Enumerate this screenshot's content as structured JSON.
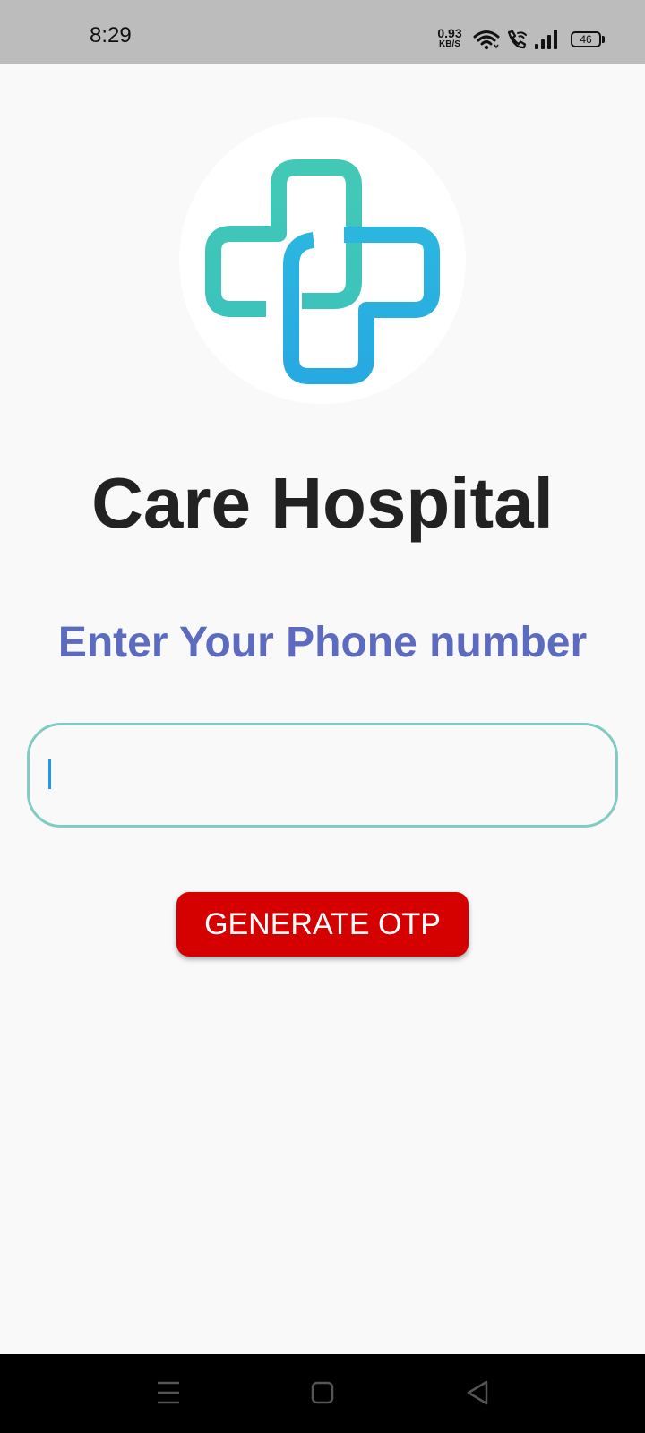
{
  "status_bar": {
    "time": "8:29",
    "net_speed_value": "0.93",
    "net_speed_unit": "KB/S",
    "battery_level": "46",
    "icons": [
      "wifi-icon",
      "wifi-call-icon",
      "signal-icon",
      "battery-icon"
    ]
  },
  "app": {
    "title": "Care Hospital",
    "logo_icon": "medical-cross-logo",
    "logo_colors": [
      "#3ec6b8",
      "#29abe2"
    ]
  },
  "login": {
    "prompt": "Enter Your Phone number",
    "phone_input_value": "",
    "phone_input_placeholder": "",
    "input_border_color": "#80cbc4",
    "button_label": "GENERATE OTP",
    "button_color": "#d50000"
  },
  "navigation_bar": {
    "buttons": [
      "menu-icon",
      "home-icon",
      "back-icon"
    ]
  }
}
